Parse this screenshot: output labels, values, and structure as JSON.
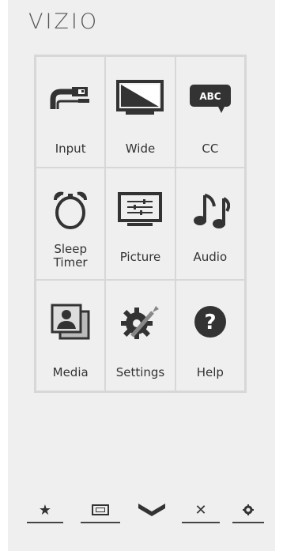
{
  "brand": {
    "logo_text": "VIZIO"
  },
  "menu": {
    "tiles": [
      {
        "label": "Input",
        "icon": "input-cable-icon"
      },
      {
        "label": "Wide",
        "icon": "wide-screen-icon"
      },
      {
        "label": "CC",
        "icon": "closed-caption-icon",
        "badge": "ABC"
      },
      {
        "label_line1": "Sleep",
        "label_line2": "Timer",
        "icon": "alarm-clock-icon"
      },
      {
        "label": "Picture",
        "icon": "picture-settings-icon"
      },
      {
        "label": "Audio",
        "icon": "music-note-icon"
      },
      {
        "label": "Media",
        "icon": "photos-icon"
      },
      {
        "label": "Settings",
        "icon": "gear-wrench-icon"
      },
      {
        "label": "Help",
        "icon": "question-icon",
        "symbol": "?"
      }
    ]
  },
  "bottom_bar": {
    "buttons": [
      {
        "icon": "star-icon",
        "glyph": "★"
      },
      {
        "icon": "aspect-ratio-icon"
      },
      {
        "icon": "chevron-down-icon"
      },
      {
        "icon": "close-icon",
        "glyph": "✕"
      },
      {
        "icon": "gear-icon",
        "glyph": "✿"
      }
    ]
  },
  "colors": {
    "panel_bg": "#efefef",
    "icon_dark": "#333333",
    "grid_line": "#d7d7d7"
  }
}
